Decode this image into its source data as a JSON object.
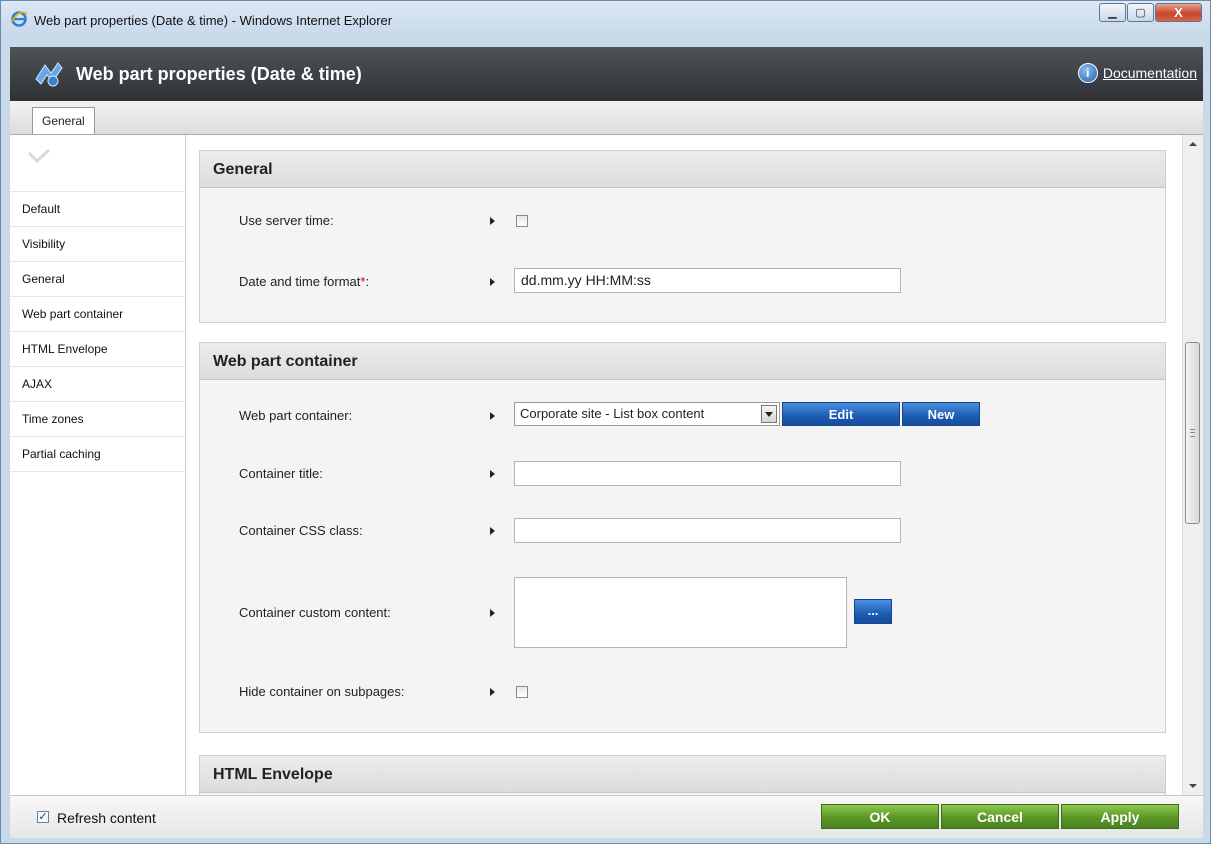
{
  "window": {
    "title": "Web part properties (Date & time) - Windows Internet Explorer",
    "buttons": {
      "minimize": "▁",
      "maximize": "▢",
      "close": "X"
    }
  },
  "header": {
    "title": "Web part properties (Date & time)",
    "documentation_label": "Documentation",
    "info_glyph": "i"
  },
  "tabs": [
    {
      "label": "General"
    }
  ],
  "sidebar": {
    "items": [
      {
        "label": "Default"
      },
      {
        "label": "Visibility"
      },
      {
        "label": "General"
      },
      {
        "label": "Web part container"
      },
      {
        "label": "HTML Envelope"
      },
      {
        "label": "AJAX"
      },
      {
        "label": "Time zones"
      },
      {
        "label": "Partial caching"
      }
    ]
  },
  "sections": {
    "general": {
      "title": "General",
      "use_server_time": {
        "label": "Use server time:",
        "checked": false
      },
      "date_time_format": {
        "label": "Date and time format",
        "required_marker": "*",
        "suffix": ":",
        "value": "dd.mm.yy HH:MM:ss"
      }
    },
    "web_part_container": {
      "title": "Web part container",
      "container": {
        "label": "Web part container:",
        "selected": "Corporate site - List box content",
        "edit_label": "Edit",
        "new_label": "New"
      },
      "container_title": {
        "label": "Container title:",
        "value": ""
      },
      "container_css_class": {
        "label": "Container CSS class:",
        "value": ""
      },
      "container_custom_content": {
        "label": "Container custom content:",
        "value": "",
        "button_label": "..."
      },
      "hide_on_subpages": {
        "label": "Hide container on subpages:",
        "checked": false
      }
    },
    "html_envelope": {
      "title": "HTML Envelope"
    }
  },
  "footer": {
    "refresh_label": "Refresh content",
    "refresh_checked": true,
    "refresh_check_glyph": "✓",
    "ok_label": "OK",
    "cancel_label": "Cancel",
    "apply_label": "Apply"
  },
  "colors": {
    "header_bg": "#3a3e42",
    "primary_button": "#1d5bb3",
    "confirm_button": "#5b9626",
    "required": "#dd0000"
  }
}
